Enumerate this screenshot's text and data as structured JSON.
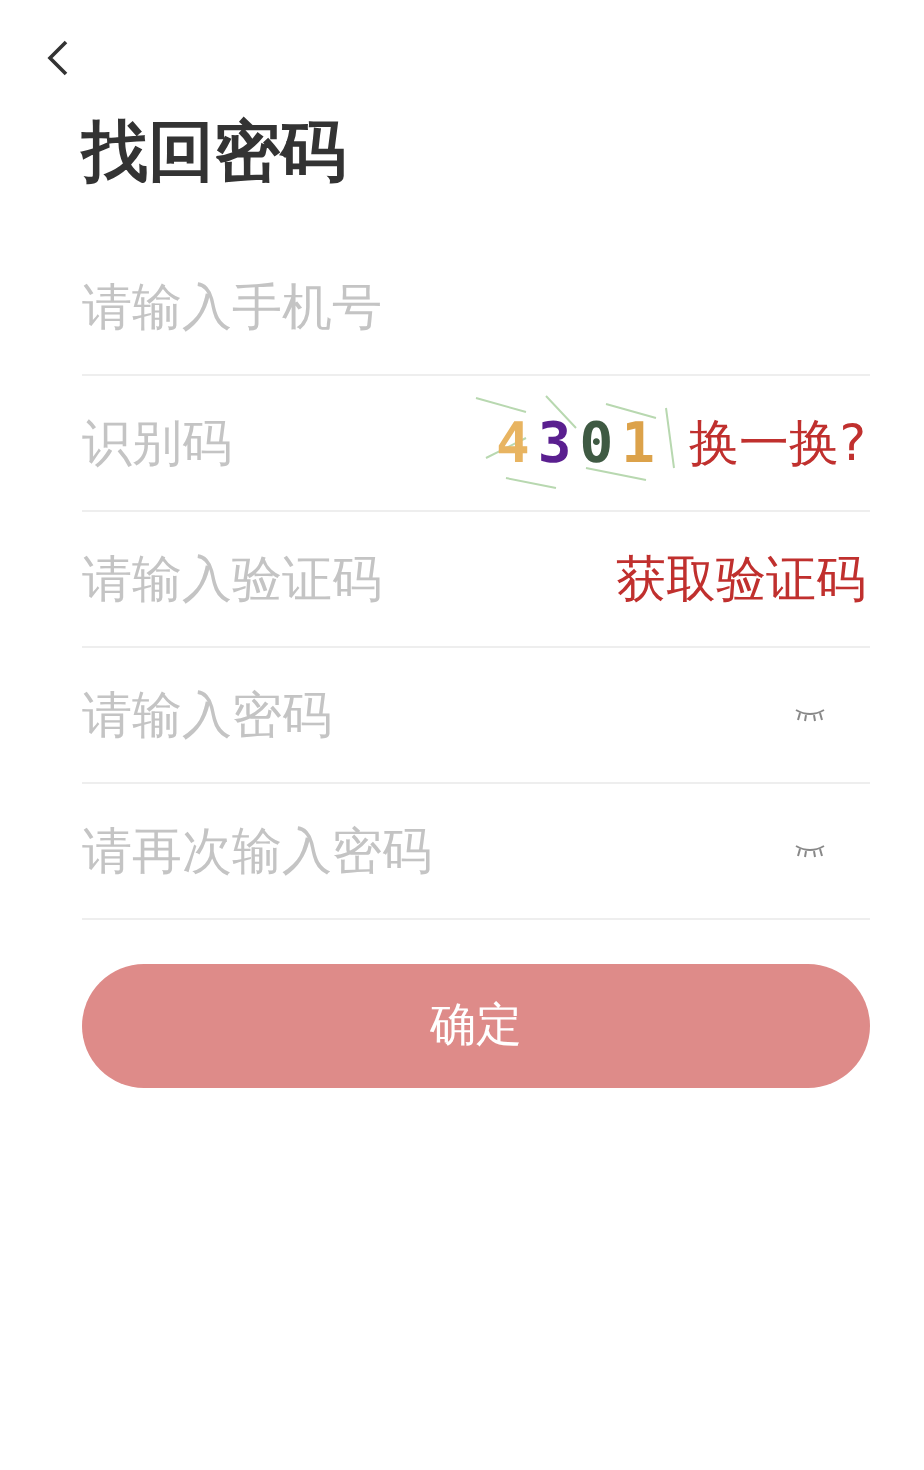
{
  "title": "找回密码",
  "fields": [
    {
      "kind": "plain",
      "placeholder": "请输入手机号"
    },
    {
      "kind": "captcha",
      "placeholder": "识别码",
      "captcha": [
        {
          "char": "4",
          "color": "#e8b461"
        },
        {
          "char": "3",
          "color": "#5a1f8f"
        },
        {
          "char": "0",
          "color": "#3f5a43"
        },
        {
          "char": "1",
          "color": "#dca24a"
        }
      ],
      "action": "换一换?"
    },
    {
      "kind": "sms",
      "placeholder": "请输入验证码",
      "action": "获取验证码"
    },
    {
      "kind": "password",
      "placeholder": "请输入密码"
    },
    {
      "kind": "password",
      "placeholder": "请再次输入密码"
    }
  ],
  "submit": "确定"
}
